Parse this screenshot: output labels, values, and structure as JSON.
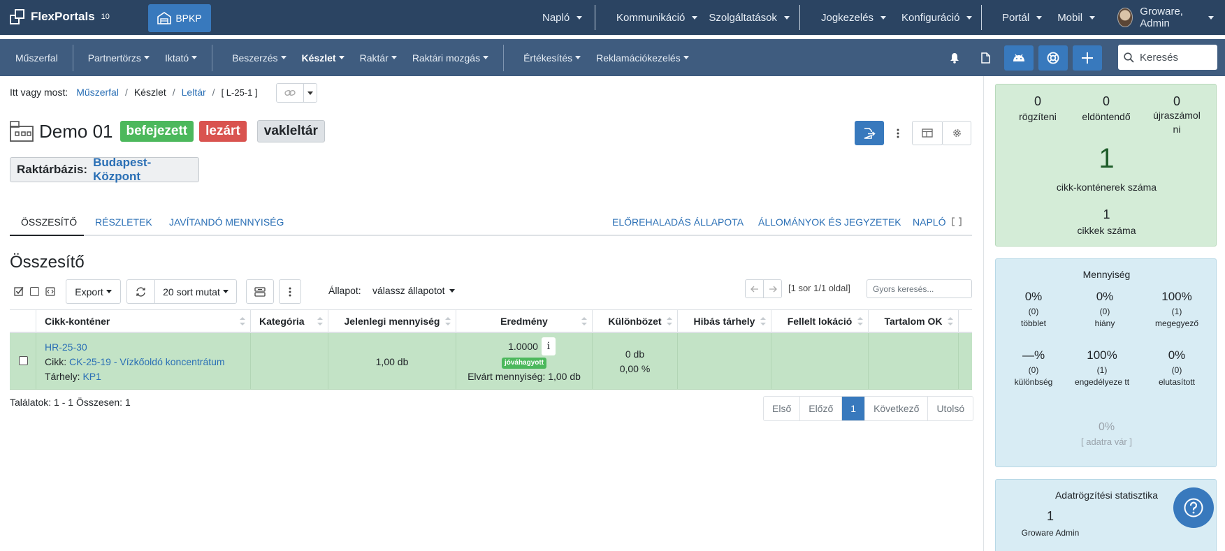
{
  "app": {
    "name": "FlexPortals",
    "version": "10",
    "site_button": "BPKP"
  },
  "topnav": {
    "group1": [
      "Napló"
    ],
    "group2": [
      "Kommunikáció",
      "Szolgáltatások"
    ],
    "group3": [
      "Jogkezelés",
      "Konfiguráció"
    ],
    "group4": [
      "Portál",
      "Mobil"
    ],
    "user": "Groware, Admin"
  },
  "subnav": {
    "dashboard": "Műszerfal",
    "group1": [
      "Partnertörzs",
      "Iktató"
    ],
    "group2": [
      "Beszerzés",
      "Készlet",
      "Raktár",
      "Raktári mozgás"
    ],
    "group3": [
      "Értékesítés",
      "Reklamációkezelés"
    ],
    "search_placeholder": "Keresés"
  },
  "breadcrumb": {
    "prefix": "Itt vagy most:",
    "items": [
      "Műszerfal",
      "Készlet",
      "Leltár",
      "[ L-25-1 ]"
    ]
  },
  "record": {
    "title": "Demo 01",
    "badges": [
      "befejezett",
      "lezárt",
      "vakleltár"
    ],
    "base_label": "Raktárbázis:",
    "base_value": "Budapest-Központ"
  },
  "tabs": {
    "left": [
      "ÖSSZESÍTŐ",
      "RÉSZLETEK",
      "JAVÍTANDÓ MENNYISÉG"
    ],
    "right": [
      "ELŐREHALADÁS ÁLLAPOTA",
      "ÁLLOMÁNYOK ÉS JEGYZETEK",
      "NAPLÓ"
    ]
  },
  "section_title": "Összesítő",
  "toolbar": {
    "export": "Export",
    "rows": "20 sort mutat",
    "status_label": "Állapot:",
    "status_value": "válassz állapotot",
    "page_info": "[1 sor 1/1 oldal]",
    "quick_search_placeholder": "Gyors keresés..."
  },
  "table": {
    "columns": [
      "Cikk-konténer",
      "Kategória",
      "Jelenlegi mennyiség",
      "Eredmény",
      "Különbözet",
      "Hibás tárhely",
      "Fellelt lokáció",
      "Tartalom OK"
    ],
    "rows": [
      {
        "container": "HR-25-30",
        "item_label": "Cikk:",
        "item": "CK-25-19 - Vízkőoldó koncentrátum",
        "loc_label": "Tárhely:",
        "loc": "KP1",
        "current_qty": "1,00 db",
        "result": "1.0000",
        "result_badge": "jóváhagyott",
        "expected": "Elvárt mennyiség: 1,00 db",
        "diff_qty": "0 db",
        "diff_pct": "0,00 %"
      }
    ]
  },
  "results": "Találatok: 1 - 1 Összesen: 1",
  "pager": [
    "Első",
    "Előző",
    "1",
    "Következő",
    "Utolsó"
  ],
  "summary": {
    "counts": [
      {
        "value": "0",
        "label": "rögzíteni"
      },
      {
        "value": "0",
        "label": "eldöntendő"
      },
      {
        "value": "0",
        "label": "újraszámol ni"
      }
    ],
    "containers": {
      "value": "1",
      "label": "cikk-konténerek száma"
    },
    "items": {
      "value": "1",
      "label": "cikkek száma"
    }
  },
  "quantity": {
    "title": "Mennyiség",
    "stats": [
      {
        "pct": "0%",
        "count": "(0)",
        "label": "többlet"
      },
      {
        "pct": "0%",
        "count": "(0)",
        "label": "hiány"
      },
      {
        "pct": "100%",
        "count": "(1)",
        "label": "megegyező"
      },
      {
        "pct": "—%",
        "count": "(0)",
        "label": "különbség"
      },
      {
        "pct": "100%",
        "count": "(1)",
        "label": "engedélyeze tt"
      },
      {
        "pct": "0%",
        "count": "(0)",
        "label": "elutasított"
      }
    ],
    "pending_pct": "0%",
    "pending_label": "[ adatra vár ]"
  },
  "capture": {
    "title": "Adatrögzítési statisztika",
    "value": "1",
    "user": "Groware Admin"
  },
  "colors": {
    "topbar": "#2b4462",
    "subbar": "#3f5c7f",
    "primary": "#3879bd",
    "success": "#4cb85c",
    "danger": "#d9534f",
    "row": "#c3e3c6"
  }
}
